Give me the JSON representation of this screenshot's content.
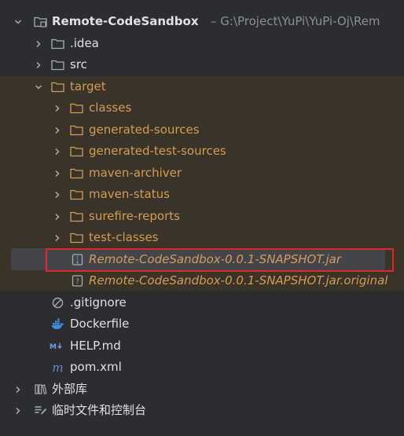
{
  "project": {
    "name": "Remote-CodeSandbox",
    "path": "– G:\\Project\\YuPi\\YuPi-Oj\\Rem"
  },
  "items": {
    "idea": ".idea",
    "src": "src",
    "target": "target",
    "classes": "classes",
    "generated_sources": "generated-sources",
    "generated_test_sources": "generated-test-sources",
    "maven_archiver": "maven-archiver",
    "maven_status": "maven-status",
    "surefire_reports": "surefire-reports",
    "test_classes": "test-classes",
    "jar": "Remote-CodeSandbox-0.0.1-SNAPSHOT.jar",
    "jar_original": "Remote-CodeSandbox-0.0.1-SNAPSHOT.jar.original",
    "gitignore": ".gitignore",
    "dockerfile": "Dockerfile",
    "help": "HELP.md",
    "pom": "pom.xml",
    "external_libs": "外部库",
    "scratches": "临时文件和控制台"
  },
  "colors": {
    "background": "#2b2d30",
    "excluded_band": "#3a3327",
    "excluded_text": "#d29c5a",
    "selection": "#43454a",
    "highlight_border": "#e0282c",
    "folder_icon": "#a8adb3",
    "maven_icon": "#5b8ed6",
    "docker_icon": "#3d8fdb"
  }
}
